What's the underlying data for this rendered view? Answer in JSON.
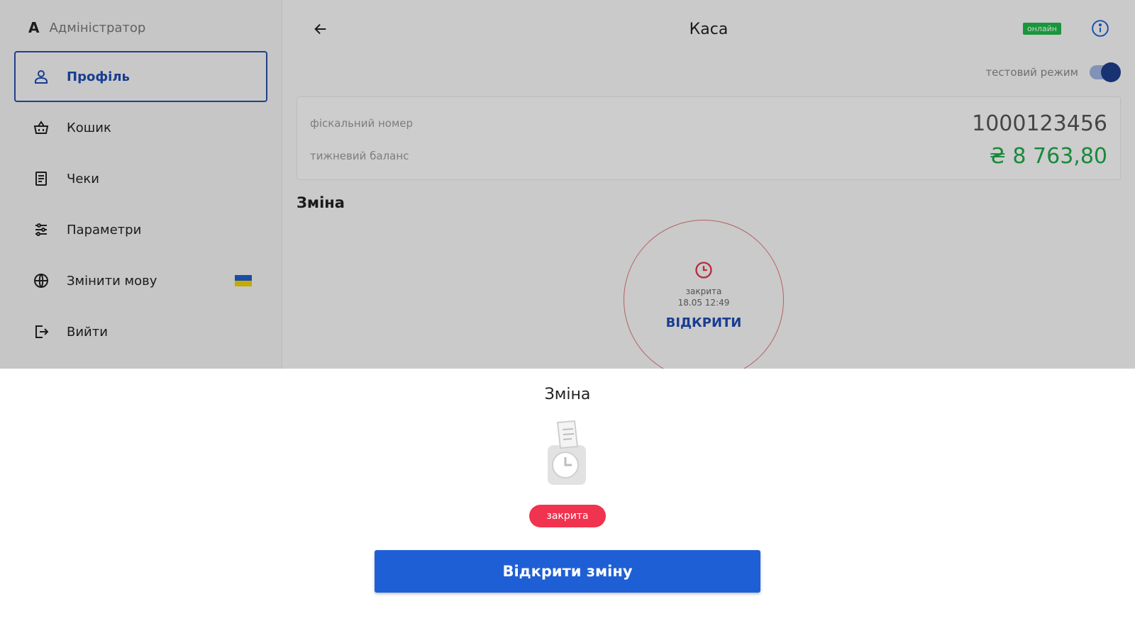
{
  "sidebar": {
    "letter": "A",
    "role": "Адміністратор",
    "items": [
      {
        "label": "Профіль",
        "icon": "user-icon",
        "active": true
      },
      {
        "label": "Кошик",
        "icon": "basket-icon"
      },
      {
        "label": "Чеки",
        "icon": "receipts-icon"
      },
      {
        "label": "Параметри",
        "icon": "sliders-icon"
      },
      {
        "label": "Змінити мову",
        "icon": "globe-icon",
        "flag": "ua"
      },
      {
        "label": "Вийти",
        "icon": "logout-icon"
      }
    ]
  },
  "header": {
    "title": "Каса",
    "status_badge": "онлайн",
    "test_mode_label": "тестовий режим",
    "test_mode_on": true
  },
  "register": {
    "fiscal_label": "фіскальний номер",
    "fiscal_value": "1000123456",
    "balance_label": "тижневий баланс",
    "balance_value": "₴ 8 763,80"
  },
  "shift": {
    "section_title": "Зміна",
    "status": "закрита",
    "timestamp": "18.05 12:49",
    "open_link": "ВІДКРИТИ"
  },
  "sheet": {
    "title": "Зміна",
    "status": "закрита",
    "button_label": "Відкрити зміну"
  },
  "colors": {
    "primary": "#1f5fd6",
    "closed": "#f0334f",
    "online": "#1fb848",
    "balance": "#1fa84a"
  }
}
